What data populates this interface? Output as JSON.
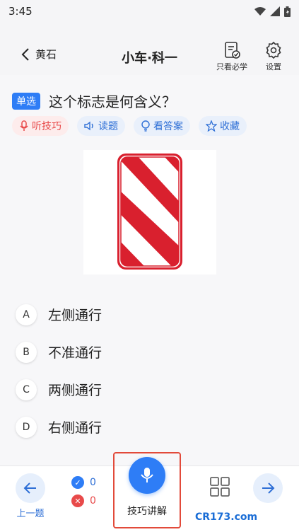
{
  "status": {
    "time": "3:45"
  },
  "header": {
    "back_label": "黄石",
    "title": "小车·科一",
    "only_must_label": "只看必学",
    "settings_label": "设置"
  },
  "question": {
    "type_tag": "单选",
    "text": "这个标志是何含义？"
  },
  "actions": [
    {
      "label": "听技巧",
      "icon": "mic-icon"
    },
    {
      "label": "读题",
      "icon": "speaker-icon"
    },
    {
      "label": "看答案",
      "icon": "bulb-icon"
    },
    {
      "label": "收藏",
      "icon": "star-icon"
    }
  ],
  "options": [
    {
      "letter": "A",
      "text": "左侧通行"
    },
    {
      "letter": "B",
      "text": "不准通行"
    },
    {
      "letter": "C",
      "text": "两侧通行"
    },
    {
      "letter": "D",
      "text": "右侧通行"
    }
  ],
  "bottom": {
    "prev_label": "上一题",
    "correct_count": "0",
    "wrong_count": "0",
    "skill_label": "技巧讲解",
    "watermark": "CR173.com"
  },
  "colors": {
    "accent": "#2e7df6",
    "danger": "#e84a4a",
    "sign_red": "#d9202e"
  }
}
